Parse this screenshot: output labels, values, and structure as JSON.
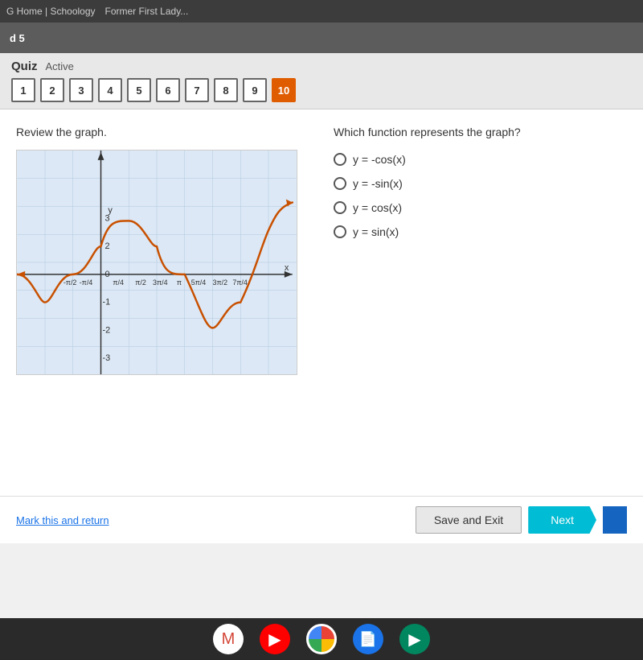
{
  "browser": {
    "bar_items": [
      "G Home | Schoology",
      "Former First Lady..."
    ]
  },
  "top_bar": {
    "breadcrumb": "d 5"
  },
  "quiz": {
    "title": "Quiz",
    "status": "Active",
    "question_numbers": [
      1,
      2,
      3,
      4,
      5,
      6,
      7,
      8,
      9,
      10
    ],
    "active_question": 10
  },
  "question": {
    "review_text": "Review the graph.",
    "which_text": "Which function represents the graph?",
    "options": [
      "y = -cos(x)",
      "y = -sin(x)",
      "y = cos(x)",
      "y = sin(x)"
    ]
  },
  "footer": {
    "mark_return": "Mark this and return",
    "save_exit": "Save and Exit",
    "next": "Next"
  },
  "taskbar": {
    "icons": [
      "gmail",
      "youtube",
      "chrome",
      "docs",
      "play"
    ]
  }
}
